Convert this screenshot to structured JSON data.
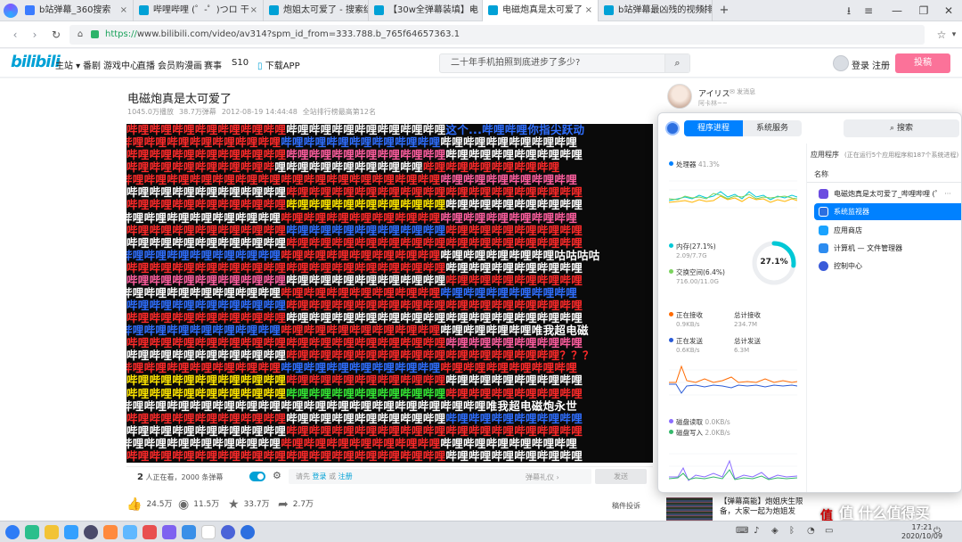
{
  "browser": {
    "tabs": [
      {
        "title": "b站弹幕_360搜索",
        "icon_color": "#3b7cff"
      },
      {
        "title": "哔哩哔哩 (゜-゜)つロ 干",
        "icon_color": "#00a1d6"
      },
      {
        "title": "炮姐太可爱了 - 搜索结",
        "icon_color": "#00a1d6"
      },
      {
        "title": "【30w全弹幕装填】电",
        "icon_color": "#00a1d6"
      },
      {
        "title": "电磁炮真是太可爱了",
        "icon_color": "#00a1d6"
      },
      {
        "title": "b站弹幕最凶残的视频排",
        "icon_color": "#00a1d6"
      }
    ],
    "new_tab_label": "+",
    "url_scheme": "https://",
    "url_rest": "www.bilibili.com/video/av314?spm_id_from=333.788.b_765f64657363.1"
  },
  "site": {
    "logo": "bilibili",
    "nav": [
      "主站",
      "番剧",
      "游戏中心",
      "直播",
      "会员购",
      "漫画",
      "赛事",
      "S10",
      "下载APP"
    ],
    "search_placeholder": "二十年手机拍照到底进步了多少?",
    "login": "登录",
    "register": "注册",
    "upload": "投稿"
  },
  "video": {
    "title": "电磁炮真是太可爱了",
    "plays": "1045.0万播放",
    "danmaku_count": "38.7万弹幕",
    "date": "2012-08-19 14:44:48",
    "rank": "全站排行榜最高第12名"
  },
  "danmaku_rows": [
    {
      "text": "哔哩哔哩哔哩哔哩哔哩哔哩哔哩哔哩哔哩哔哩哔哩哔哩哔哩哔哩这个...哔哩哔哩你指尖跃动",
      "colors": [
        "#ff2a2a",
        "#ffffff",
        "#2f6fff"
      ]
    },
    {
      "text": "哔哩哔哩哔哩哔哩哔哩哔哩哔哩哔哩哔哩哔哩哔哩哔哩哔哩哔哩哔哩哔哩哔哩哔哩哔哩哔哩",
      "colors": [
        "#ff2a2a",
        "#2f6fff",
        "#ffffff"
      ]
    },
    {
      "text": "哔哩哔哩哔哩哔哩哔哩哔哩哔哩哔哩哔哩哔哩哔哩哔哩哔哩哔哩哔哩哔哩哔哩哔哩哔哩哔哩",
      "colors": [
        "#ff2a2a",
        "#ff5fa0",
        "#ffffff"
      ]
    },
    {
      "text": "哔哩哔哩哔哩哔哩哔哩哔哩哔哩哔哩哔哩哔哩哔哩哔哩哔哩哔哩哔哩哔哩哔哩哔哩哔哩",
      "colors": [
        "#ff2a2a",
        "#ffffff",
        "#ff2a2a"
      ]
    },
    {
      "text": "哔哩哔哩哔哩哔哩哔哩哔哩哔哩哔哩哔哩哔哩哔哩哔哩哔哩哔哩哔哩哔哩哔哩哔哩哔哩哔哩",
      "colors": [
        "#ff2a2a",
        "#ff2a2a",
        "#ff5fa0"
      ]
    },
    {
      "text": "哔哩哔哩哔哩哔哩哔哩哔哩哔哩哔哩哔哩哔哩哔哩哔哩哔哩哔哩哔哩哔哩哔哩哔哩哔哩哔哩",
      "colors": [
        "#ffffff",
        "#ff2a2a",
        "#ff2a2a"
      ]
    },
    {
      "text": "哔哩哔哩哔哩哔哩哔哩哔哩哔哩哔哩哔哩哔哩哔哩哔哩哔哩哔哩哔哩哔哩哔哩哔哩哔哩哔哩",
      "colors": [
        "#ff2a2a",
        "#ffe600",
        "#ffffff"
      ]
    },
    {
      "text": "哔哩哔哩哔哩哔哩哔哩哔哩哔哩哔哩哔哩哔哩哔哩哔哩哔哩哔哩哔哩哔哩哔哩哔哩哔哩哔哩",
      "colors": [
        "#ffffff",
        "#ff2a2a",
        "#ff5fa0"
      ]
    },
    {
      "text": "哔哩哔哩哔哩哔哩哔哩哔哩哔哩哔哩哔哩哔哩哔哩哔哩哔哩哔哩哔哩哔哩哔哩哔哩哔哩哔哩",
      "colors": [
        "#ff2a2a",
        "#2f6fff",
        "#ff2a2a"
      ]
    },
    {
      "text": "哔哩哔哩哔哩哔哩哔哩哔哩哔哩哔哩哔哩哔哩哔哩哔哩哔哩哔哩哔哩哔哩哔哩哔哩哔哩哔哩",
      "colors": [
        "#ffffff",
        "#ff2a2a",
        "#ff2a2a"
      ]
    },
    {
      "text": "哔哩哔哩哔哩哔哩哔哩哔哩哔哩哔哩哔哩哔哩哔哩哔哩哔哩哔哩哔哩哔哩哔哩哔哩哔哩咕咕咕咕",
      "colors": [
        "#2f6fff",
        "#ff2a2a",
        "#ffffff"
      ]
    },
    {
      "text": "哔哩哔哩哔哩哔哩哔哩哔哩哔哩哔哩哔哩哔哩哔哩哔哩哔哩哔哩哔哩哔哩哔哩哔哩哔哩哔哩",
      "colors": [
        "#ff2a2a",
        "#ff2a2a",
        "#ffffff"
      ]
    },
    {
      "text": "哔哩哔哩哔哩哔哩哔哩哔哩哔哩哔哩哔哩哔哩哔哩哔哩哔哩哔哩哔哩哔哩哔哩哔哩哔哩哔哩",
      "colors": [
        "#ff5fa0",
        "#ffffff",
        "#ff2a2a"
      ]
    },
    {
      "text": "哔哩哔哩哔哩哔哩哔哩哔哩哔哩哔哩哔哩哔哩哔哩哔哩哔哩哔哩哔哩哔哩哔哩哔哩哔哩哔哩",
      "colors": [
        "#ffffff",
        "#ff2a2a",
        "#2f6fff"
      ]
    },
    {
      "text": "哔哩哔哩哔哩哔哩哔哩哔哩哔哩哔哩哔哩哔哩哔哩哔哩哔哩哔哩哔哩哔哩哔哩哔哩哔哩哔哩",
      "colors": [
        "#2f6fff",
        "#ff2a2a",
        "#ff2a2a"
      ]
    },
    {
      "text": "哔哩哔哩哔哩哔哩哔哩哔哩哔哩哔哩哔哩哔哩哔哩哔哩哔哩哔哩哔哩哔哩哔哩哔哩哔哩哔哩",
      "colors": [
        "#ff2a2a",
        "#ffffff",
        "#ffffff"
      ]
    },
    {
      "text": "哔哩哔哩哔哩哔哩哔哩哔哩哔哩哔哩哔哩哔哩哔哩哔哩哔哩哔哩哔哩哔哩哔哩哔哩唯我超电磁",
      "colors": [
        "#2f6fff",
        "#ff2a2a",
        "#ffffff"
      ]
    },
    {
      "text": "哔哩哔哩哔哩哔哩哔哩哔哩哔哩哔哩哔哩哔哩哔哩哔哩哔哩哔哩哔哩哔哩哔哩哔哩哔哩哔哩",
      "colors": [
        "#ff2a2a",
        "#ff2a2a",
        "#ff5fa0"
      ]
    },
    {
      "text": "哔哩哔哩哔哩哔哩哔哩哔哩哔哩哔哩哔哩哔哩哔哩哔哩哔哩哔哩哔哩哔哩哔哩哔哩哔哩？？？",
      "colors": [
        "#ffffff",
        "#ff2a2a",
        "#ff2a2a"
      ]
    },
    {
      "text": "哔哩哔哩哔哩哔哩哔哩哔哩哔哩哔哩哔哩哔哩哔哩哔哩哔哩哔哩哔哩哔哩哔哩哔哩哔哩哔哩",
      "colors": [
        "#ff2a2a",
        "#2f6fff",
        "#ff2a2a"
      ]
    },
    {
      "text": "哔哩哔哩哔哩哔哩哔哩哔哩哔哩哔哩哔哩哔哩哔哩哔哩哔哩哔哩哔哩哔哩哔哩哔哩哔哩哔哩",
      "colors": [
        "#ffe600",
        "#ff2a2a",
        "#ffffff"
      ]
    },
    {
      "text": "哔哩哔哩哔哩哔哩哔哩哔哩哔哩哔哩哔哩哔哩哔哩哔哩哔哩哔哩哔哩哔哩哔哩哔哩哔哩哔哩",
      "colors": [
        "#ffe600",
        "#35e835",
        "#ff2a2a"
      ]
    },
    {
      "text": "哔哩哔哩哔哩哔哩哔哩哔哩哔哩哔哩哔哩哔哩哔哩哔哩哔哩哔哩哔哩哔哩唯我超电磁炮永世",
      "colors": [
        "#ffffff",
        "#ffffff",
        "#ffffff"
      ]
    },
    {
      "text": "哔哩哔哩哔哩哔哩哔哩哔哩哔哩哔哩哔哩哔哩哔哩哔哩哔哩哔哩哔哩哔哩哔哩哔哩哔哩哔哩",
      "colors": [
        "#ff2a2a",
        "#ffffff",
        "#2f6fff"
      ]
    },
    {
      "text": "哔哩哔哩哔哩哔哩哔哩哔哩哔哩哔哩哔哩哔哩哔哩哔哩哔哩哔哩哔哩哔哩哔哩哔哩哔哩哔哩",
      "colors": [
        "#ffffff",
        "#ff2a2a",
        "#ff2a2a"
      ]
    },
    {
      "text": "哔哩哔哩哔哩哔哩哔哩哔哩哔哩哔哩哔哩哔哩哔哩哔哩哔哩哔哩哔哩哔哩哔哩哔哩哔哩哔哩",
      "colors": [
        "#ffffff",
        "#ff2a2a",
        "#ffffff"
      ]
    },
    {
      "text": "哔哩哔哩哔哩哔哩哔哩哔哩哔哩哔哩哔哩哔哩哔哩哔哩哔哩哔哩哔哩哔哩哔哩哔哩哔哩哔哩",
      "colors": [
        "#ff2a2a",
        "#ff2a2a",
        "#ffffff"
      ]
    }
  ],
  "danmaku_bar": {
    "watching_count": "2",
    "watching_text": "人正在看，2000 条弹幕",
    "please": "请先",
    "login": "登录",
    "or": "或",
    "register": "注册",
    "etiquette": "弹幕礼仪 ›",
    "send": "发送"
  },
  "actions": {
    "like": "24.5万",
    "coin": "11.5万",
    "fav": "33.7万",
    "share": "2.7万",
    "report": "稿件投诉"
  },
  "uploader": {
    "name": "アイリス",
    "message": "发消息",
    "sign": "阿卡林~~"
  },
  "recommend": {
    "title_line1": "【弹幕高能】炮姐庆生限",
    "title_line2": "备，大家一起为炮姐发"
  },
  "monitor": {
    "tab_process": "程序进程",
    "tab_service": "系统服务",
    "search": "搜索",
    "cpu_label": "处理器",
    "cpu_value": "41.3%",
    "mem_label": "内存(27.1%)",
    "mem_value": "2.09/7.7G",
    "swap_label": "交换空间(6.4%)",
    "swap_value": "716.00/11.0G",
    "mem_percent": 27.1,
    "mem_percent_text": "27.1%",
    "recv_label": "正在接收",
    "recv_value": "0.9KB/s",
    "recv_total_label": "总计接收",
    "recv_total_value": "234.7M",
    "send_label": "正在发送",
    "send_value": "0.6KB/s",
    "send_total_label": "总计发送",
    "send_total_value": "6.3M",
    "disk_read_label": "磁盘读取",
    "disk_read_value": "0.0KB/s",
    "disk_write_label": "磁盘写入",
    "disk_write_value": "2.0KB/s",
    "apps_title": "应用程序",
    "apps_sub": "(正在运行5个应用程序和187个系统进程)",
    "col_name": "名称",
    "apps": [
      {
        "name": "电磁炮真是太可爱了_哔哩哔哩 (゜",
        "icon_color": "#6b4ce0",
        "selected": false
      },
      {
        "name": "系统监视器",
        "icon_color": "#2c6fe0",
        "selected": true
      },
      {
        "name": "应用商店",
        "icon_color": "#1aa3ff",
        "selected": false
      },
      {
        "name": "计算机 — 文件管理器",
        "icon_color": "#2d8cf0",
        "selected": false
      },
      {
        "name": "控制中心",
        "icon_color": "#3a5bd9",
        "selected": false
      }
    ]
  },
  "taskbar": {
    "clock_time": "17:21",
    "clock_date": "2020/10/09"
  },
  "watermark": "值 什么值得买",
  "colors": {
    "accent": "#00a1d6",
    "pink": "#fb7299",
    "monitor_blue": "#0081ff"
  }
}
